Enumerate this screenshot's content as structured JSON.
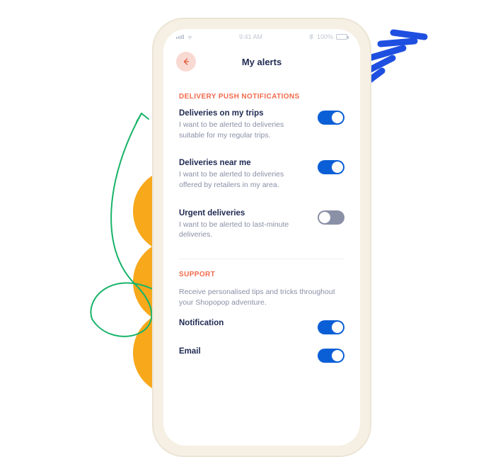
{
  "status_bar": {
    "time": "9:41 AM",
    "battery_text": "100%"
  },
  "header": {
    "title": "My alerts"
  },
  "sections": {
    "delivery": {
      "label": "DELIVERY PUSH NOTIFICATIONS",
      "items": [
        {
          "title": "Deliveries on my trips",
          "desc": "I want to be alerted to deliveries suitable for my regular trips.",
          "on": true
        },
        {
          "title": "Deliveries near me",
          "desc": "I want to be alerted to deliveries offered by retailers in my area.",
          "on": true
        },
        {
          "title": "Urgent deliveries",
          "desc": "I want to be alerted to last-minute deliveries.",
          "on": false
        }
      ]
    },
    "support": {
      "label": "SUPPORT",
      "desc": "Receive personalised tips and tricks throughout your Shopopop adventure.",
      "items": [
        {
          "title": "Notification",
          "on": true
        },
        {
          "title": "Email",
          "on": true
        }
      ]
    }
  }
}
